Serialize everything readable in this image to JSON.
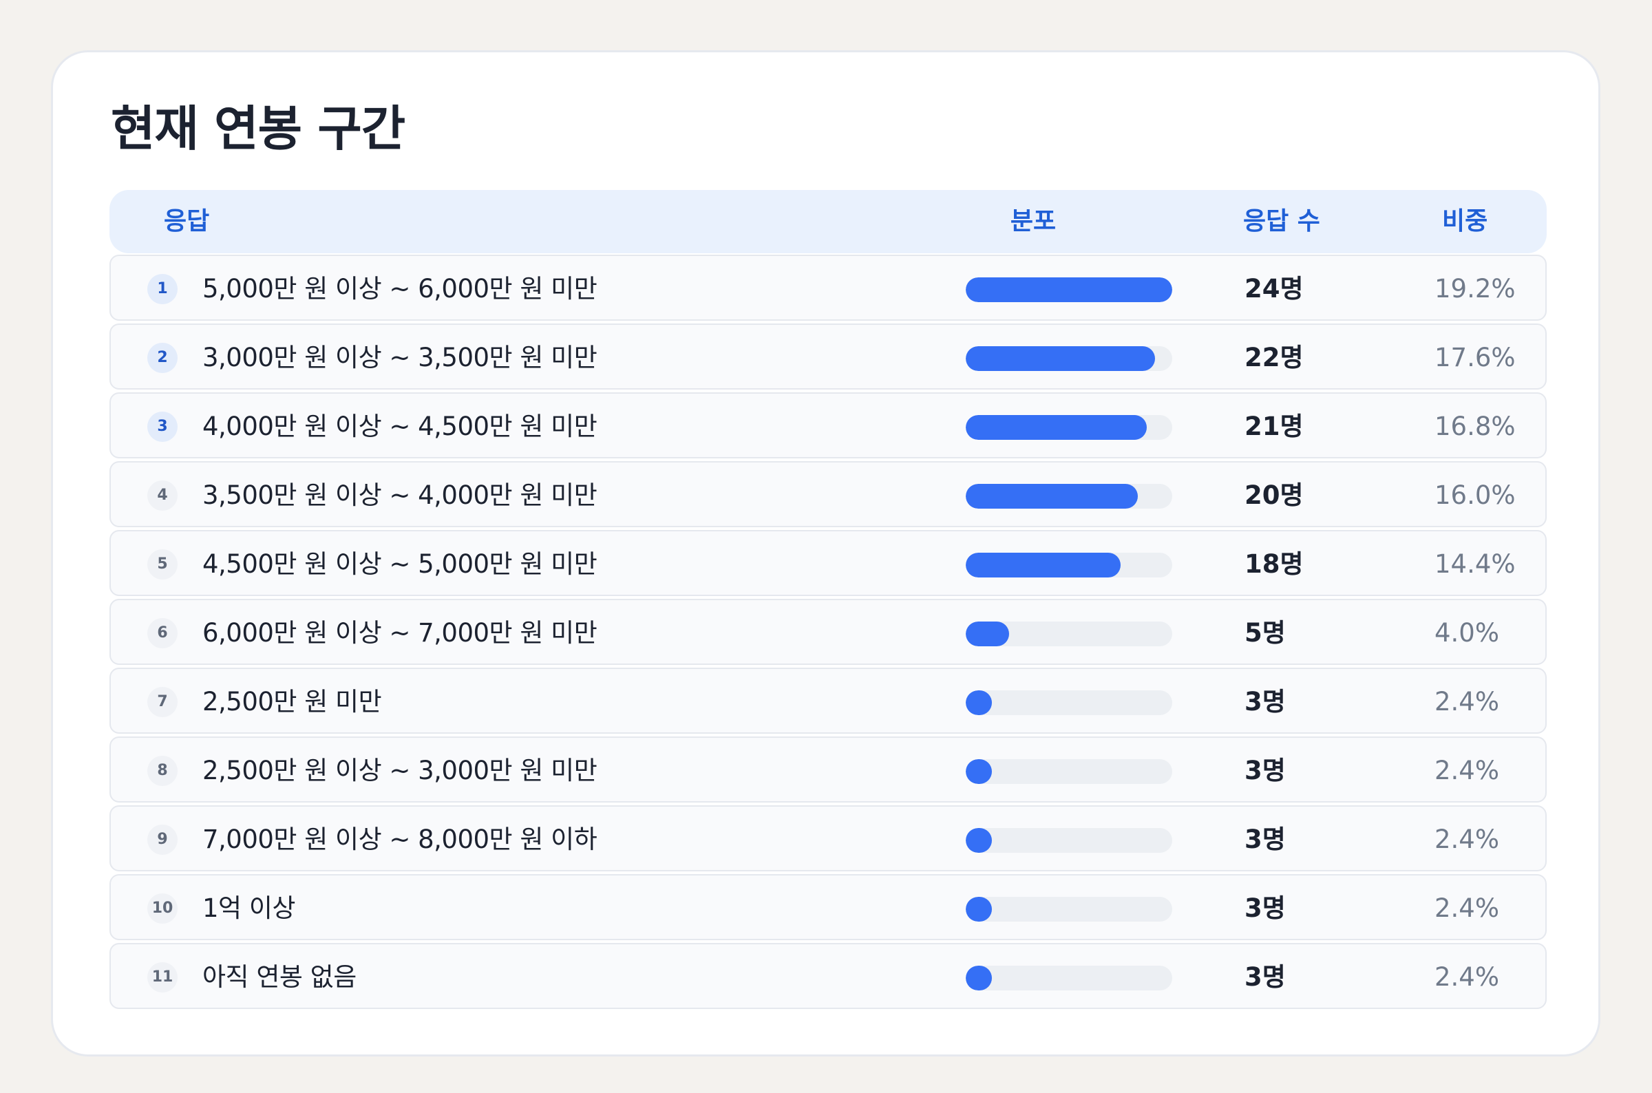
{
  "title": "현재 연봉 구간",
  "columns": {
    "answer": "응답",
    "distribution": "분포",
    "count": "응답 수",
    "ratio": "비중"
  },
  "rows": [
    {
      "rank": "1",
      "label": "5,000만 원 이상 ~ 6,000만 원 미만",
      "count": "24명",
      "ratio": "19.2%"
    },
    {
      "rank": "2",
      "label": "3,000만 원 이상 ~ 3,500만 원 미만",
      "count": "22명",
      "ratio": "17.6%"
    },
    {
      "rank": "3",
      "label": "4,000만 원 이상 ~ 4,500만 원 미만",
      "count": "21명",
      "ratio": "16.8%"
    },
    {
      "rank": "4",
      "label": "3,500만 원 이상 ~ 4,000만 원 미만",
      "count": "20명",
      "ratio": "16.0%"
    },
    {
      "rank": "5",
      "label": "4,500만 원 이상 ~ 5,000만 원 미만",
      "count": "18명",
      "ratio": "14.4%"
    },
    {
      "rank": "6",
      "label": "6,000만 원 이상 ~ 7,000만 원 미만",
      "count": "5명",
      "ratio": "4.0%"
    },
    {
      "rank": "7",
      "label": "2,500만 원 미만",
      "count": "3명",
      "ratio": "2.4%"
    },
    {
      "rank": "8",
      "label": "2,500만 원 이상 ~ 3,000만 원 미만",
      "count": "3명",
      "ratio": "2.4%"
    },
    {
      "rank": "9",
      "label": "7,000만 원 이상 ~ 8,000만 원 이하",
      "count": "3명",
      "ratio": "2.4%"
    },
    {
      "rank": "10",
      "label": "1억 이상",
      "count": "3명",
      "ratio": "2.4%"
    },
    {
      "rank": "11",
      "label": "아직 연봉 없음",
      "count": "3명",
      "ratio": "2.4%"
    }
  ],
  "chart_data": {
    "type": "bar",
    "orientation": "horizontal",
    "title": "현재 연봉 구간",
    "categories": [
      "5,000만 원 이상 ~ 6,000만 원 미만",
      "3,000만 원 이상 ~ 3,500만 원 미만",
      "4,000만 원 이상 ~ 4,500만 원 미만",
      "3,500만 원 이상 ~ 4,000만 원 미만",
      "4,500만 원 이상 ~ 5,000만 원 미만",
      "6,000만 원 이상 ~ 7,000만 원 미만",
      "2,500만 원 미만",
      "2,500만 원 이상 ~ 3,000만 원 미만",
      "7,000만 원 이상 ~ 8,000만 원 이하",
      "1억 이상",
      "아직 연봉 없음"
    ],
    "values": [
      24,
      22,
      21,
      20,
      18,
      5,
      3,
      3,
      3,
      3,
      3
    ],
    "percentages": [
      19.2,
      17.6,
      16.8,
      16.0,
      14.4,
      4.0,
      2.4,
      2.4,
      2.4,
      2.4,
      2.4
    ],
    "xlim": [
      0,
      24
    ],
    "colors": {
      "bar": "#356ff5",
      "track": "#eceff3",
      "header_text": "#1f5fd6"
    }
  }
}
